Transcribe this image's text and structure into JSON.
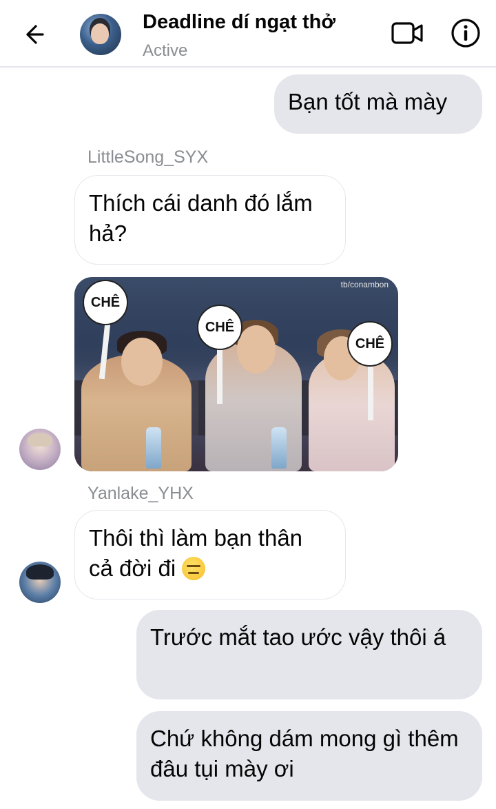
{
  "header": {
    "title": "Deadline dí ngạt thở",
    "status": "Active"
  },
  "messages": [
    {
      "type": "outgoing",
      "text": "Bạn tốt mà mày"
    },
    {
      "type": "incoming",
      "sender": "LittleSong_SYX",
      "text": "Thích cái danh đó lắm hả?"
    },
    {
      "type": "incoming_image",
      "image": {
        "sign_text": "CHÊ",
        "watermark": "tb/conambon"
      }
    },
    {
      "type": "incoming",
      "sender": "Yanlake_YHX",
      "text": "Thôi thì làm bạn thân cả đời đi",
      "emoji": "expressionless-face"
    },
    {
      "type": "outgoing",
      "text": "Trước mắt tao ước vậy thôi á"
    },
    {
      "type": "outgoing",
      "text": "Chứ không dám mong gì thêm đâu tụi mày ơi"
    }
  ],
  "icons": {
    "back": "arrow-left-icon",
    "video": "video-camera-icon",
    "info": "info-icon"
  },
  "colors": {
    "outgoing_bubble": "#e4e6eb",
    "incoming_border": "#e4e6eb",
    "muted_text": "#8a8d91"
  }
}
